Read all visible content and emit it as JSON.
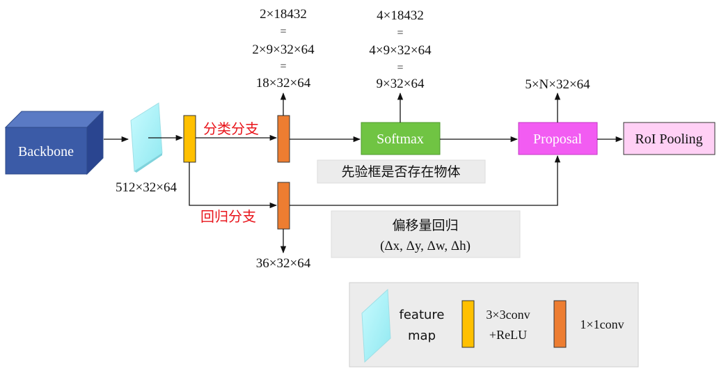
{
  "nodes": {
    "backbone": "Backbone",
    "softmax": "Softmax",
    "proposal": "Proposal",
    "roi_pooling": "RoI Pooling"
  },
  "labels": {
    "feature_map_dim": "512×32×64",
    "cls_branch": "分类分支",
    "reg_branch": "回归分支",
    "cls_out_line1": "2×18432",
    "cls_out_eq1": "=",
    "cls_out_line2": "2×9×32×64",
    "cls_out_eq2": "=",
    "cls_out_line3": "18×32×64",
    "softmax_out_line1": "4×18432",
    "softmax_out_eq1": "=",
    "softmax_out_line2": "4×9×32×64",
    "softmax_out_eq2": "=",
    "softmax_out_line3": "9×32×64",
    "proposal_out": "5×N×32×64",
    "reg_out": "36×32×64",
    "anchor_note": "先验框是否存在物体",
    "offset_note_line1": "偏移量回归",
    "offset_note_line2": "(Δx, Δy, Δw, Δh)"
  },
  "legend": {
    "feature_map_line1": "feature",
    "feature_map_line2": "map",
    "conv3_line1": "3×3conv",
    "conv3_line2": "+ReLU",
    "conv1": "1×1conv"
  },
  "colors": {
    "backbone": "#3b5ba7",
    "feature_map": "#aef3f8",
    "conv3": "#ffc000",
    "conv1": "#ed7d31",
    "softmax": "#70c443",
    "proposal": "#f25cf2",
    "roi_pooling": "#ffd0f5",
    "note_bg": "#ececec",
    "branch_text": "#e8141b"
  }
}
